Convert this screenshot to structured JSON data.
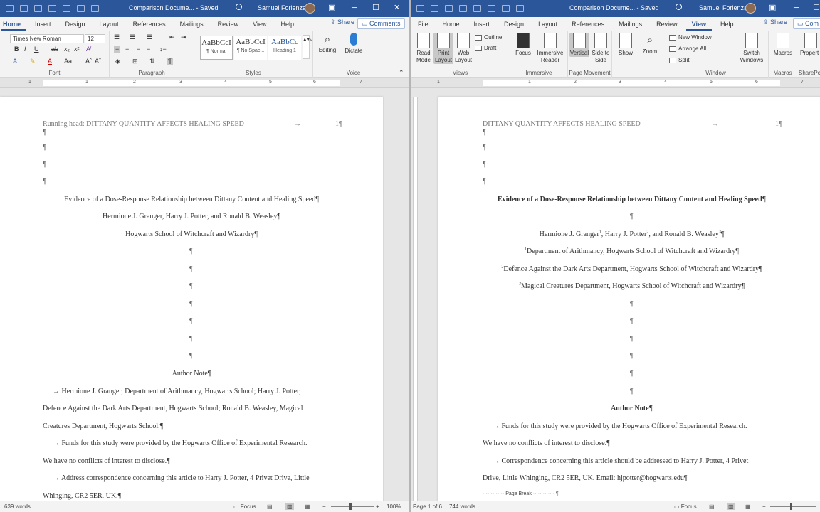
{
  "left_window": {
    "title": "Comparison Docume... - Saved",
    "user": "Samuel Forlenza",
    "tabs": [
      "Home",
      "Insert",
      "Design",
      "Layout",
      "References",
      "Mailings",
      "Review",
      "View",
      "Help"
    ],
    "active_tab": "Home",
    "share_label": "Share",
    "comments_label": "Comments",
    "ribbon": {
      "font_name": "Times New Roman",
      "font_size": "12",
      "styles": [
        {
          "preview": "AaBbCcI",
          "name": "¶ Normal"
        },
        {
          "preview": "AaBbCcI",
          "name": "¶ No Spac..."
        },
        {
          "preview": "AaBbCc",
          "name": "Heading 1"
        }
      ],
      "group_labels": {
        "font": "Font",
        "paragraph": "Paragraph",
        "styles": "Styles",
        "voice": "Voice"
      },
      "editing_label": "Editing",
      "dictate_label": "Dictate"
    },
    "ruler_numbers": [
      "1",
      "1",
      "2",
      "3",
      "4",
      "5",
      "6",
      "7"
    ],
    "document": {
      "running_head": "Running head: DITTANY QUANTITY AFFECTS HEALING SPEED",
      "page_number": "1¶",
      "title": "Evidence of a Dose-Response Relationship between Dittany Content and Healing Speed¶",
      "authors": "Hermione J. Granger, Harry J. Potter, and Ronald B. Weasley¶",
      "affiliation": "Hogwarts School of Witchcraft and Wizardry¶",
      "author_note_heading": "Author Note¶",
      "body": [
        "→   Hermione J. Granger, Department of Arithmancy, Hogwarts School; Harry J. Potter,",
        "Defence Against the Dark Arts Department, Hogwarts School; Ronald B. Weasley, Magical",
        "Creatures Department, Hogwarts School.¶",
        "→   Funds for this study were provided by the Hogwarts Office of Experimental Research.",
        "We have no conflicts of interest to disclose.¶",
        "→   Address correspondence concerning this article to Harry J. Potter, 4 Privet Drive, Little",
        "Whinging, CR2 5ER, UK.¶"
      ]
    },
    "status": {
      "words": "639 words",
      "focus": "Focus",
      "zoom": "100%"
    }
  },
  "right_window": {
    "title": "Comparison Docume... - Saved",
    "user": "Samuel Forlenza",
    "tabs": [
      "File",
      "Home",
      "Insert",
      "Design",
      "Layout",
      "References",
      "Mailings",
      "Review",
      "View",
      "Help"
    ],
    "active_tab": "View",
    "share_label": "Share",
    "comments_label": "Com",
    "ribbon": {
      "views": [
        "Read Mode",
        "Print Layout",
        "Web Layout"
      ],
      "views_small": [
        "Outline",
        "Draft"
      ],
      "immersive": [
        "Focus",
        "Immersive Reader"
      ],
      "page_movement": [
        "Vertical",
        "Side to Side"
      ],
      "show_label": "Show",
      "zoom_label": "Zoom",
      "window_items": [
        "New Window",
        "Arrange All",
        "Split"
      ],
      "switch_windows": "Switch Windows",
      "macros": "Macros",
      "properties": "Propert",
      "group_labels": {
        "views": "Views",
        "immersive": "Immersive",
        "page_movement": "Page Movement",
        "window": "Window",
        "macros": "Macros",
        "sharepoint": "SharePo"
      }
    },
    "ruler_numbers": [
      "1",
      "1",
      "2",
      "3",
      "4",
      "5",
      "6",
      "7"
    ],
    "document": {
      "running_head": "DITTANY QUANTITY AFFECTS HEALING SPEED",
      "page_number": "1¶",
      "title": "Evidence of a Dose-Response Relationship between Dittany Content and Healing Speed¶",
      "authors_pre": "Hermione J. Granger",
      "authors_mid1": ", Harry J. Potter",
      "authors_mid2": ", and Ronald B. Weasley",
      "authors_end": "¶",
      "sup1": "1",
      "sup2": "2",
      "sup3": "3",
      "affil1": "Department of Arithmancy, Hogwarts School of Witchcraft and Wizardry¶",
      "affil2": "Defence Against the Dark Arts Department, Hogwarts School of Witchcraft and Wizardry¶",
      "affil3": "Magical Creatures Department, Hogwarts School of Witchcraft and Wizardry¶",
      "author_note_heading": "Author Note¶",
      "body": [
        "→   Funds for this study were provided by the Hogwarts Office of Experimental Research.",
        "We have no conflicts of interest to disclose.¶",
        "→   Correspondence concerning this article should be addressed to Harry J. Potter, 4 Privet",
        "Drive, Little Whinging, CR2 5ER, UK. Email: hjpotter@hogwarts.edu¶"
      ],
      "page_break": "Page Break"
    },
    "status": {
      "page": "Page 1 of 6",
      "words": "744 words",
      "focus": "Focus"
    }
  },
  "pilcrow": "¶",
  "colors": {
    "word_blue": "#2b579a",
    "ribbon_bg": "#f3f3f3",
    "canvas_bg": "#e6e6e6"
  }
}
